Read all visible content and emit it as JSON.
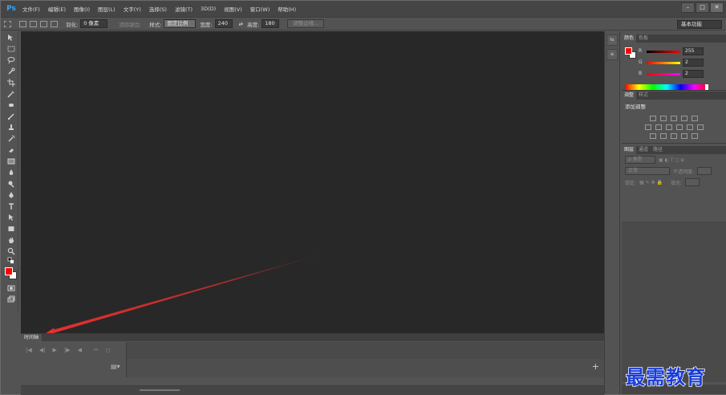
{
  "app": {
    "logo": "Ps"
  },
  "menu": [
    "文件(F)",
    "编辑(E)",
    "图像(I)",
    "图层(L)",
    "文字(Y)",
    "选择(S)",
    "滤镜(T)",
    "3D(D)",
    "视图(V)",
    "窗口(W)",
    "帮助(H)"
  ],
  "window_controls": {
    "minimize": "–",
    "restore": "□",
    "close": "✕"
  },
  "options": {
    "feather_label": "羽化:",
    "feather_value": "0 像素",
    "antialias_label": "消除锯齿",
    "style_label": "样式:",
    "style_value": "固定比例",
    "width_label": "宽度:",
    "width_value": "240",
    "swap_icon": "⇄",
    "height_label": "高度:",
    "height_value": "180",
    "refine_edge": "调整边缘...",
    "workspace": "基本功能"
  },
  "timeline": {
    "tab": "时间轴",
    "controls": [
      "|◀",
      "◀|",
      "▶",
      "|▶",
      "◀",
      "✂",
      "◻"
    ],
    "film_icon": "🎞",
    "add": "+"
  },
  "color_panel": {
    "tabs": [
      "颜色",
      "色板"
    ],
    "channels": [
      {
        "label": "R",
        "value": "255",
        "gradient": "linear-gradient(90deg,#000,#ff0000)"
      },
      {
        "label": "G",
        "value": "2",
        "gradient": "linear-gradient(90deg,#ff0000,#ffff00)"
      },
      {
        "label": "B",
        "value": "2",
        "gradient": "linear-gradient(90deg,#ff0000,#ff00ff)"
      }
    ],
    "foreground": "#ff0000",
    "background": "#ffffff"
  },
  "adjust_panel": {
    "tabs": [
      "调整",
      "样式"
    ],
    "title": "添加调整"
  },
  "layers_panel": {
    "tabs": [
      "图层",
      "通道",
      "路径"
    ],
    "kind_label": "ρ 类型",
    "blend_mode": "正常",
    "opacity_label": "不透明度:",
    "lock_label": "锁定:",
    "fill_label": "填充:"
  },
  "watermark": "最需教育",
  "colors": {
    "arrow": "#e8302f",
    "canvas": "#282828",
    "accent": "#31a8ff"
  }
}
